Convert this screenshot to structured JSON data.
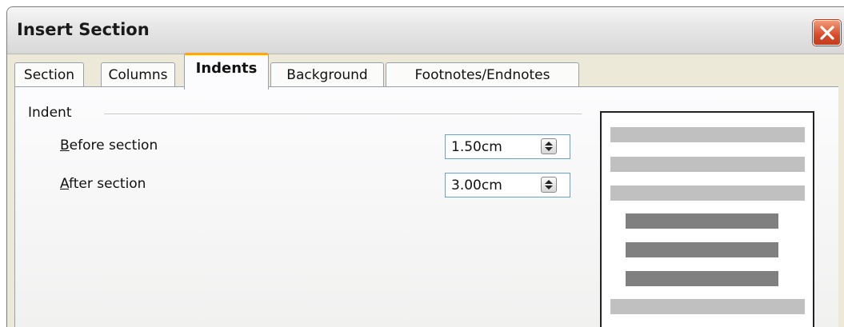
{
  "window": {
    "title": "Insert Section",
    "close_icon": "close-icon"
  },
  "tabs": [
    {
      "label": "Section",
      "active": false
    },
    {
      "label": "Columns",
      "active": false
    },
    {
      "label": "Indents",
      "active": true
    },
    {
      "label": "Background",
      "active": false
    },
    {
      "label": "Footnotes/Endnotes",
      "active": false
    }
  ],
  "indent": {
    "group_label": "Indent",
    "before": {
      "label_mnemonic": "B",
      "label_rest": "efore section",
      "value": "1.50cm"
    },
    "after": {
      "label_mnemonic": "A",
      "label_rest": "fter section",
      "value": "3.00cm"
    },
    "spin_icon": "spin-updown-icon"
  },
  "preview": {
    "description_icon": "section-indent-preview",
    "colors": {
      "text_lines": "#c0c0c0",
      "section_lines": "#808080"
    }
  }
}
